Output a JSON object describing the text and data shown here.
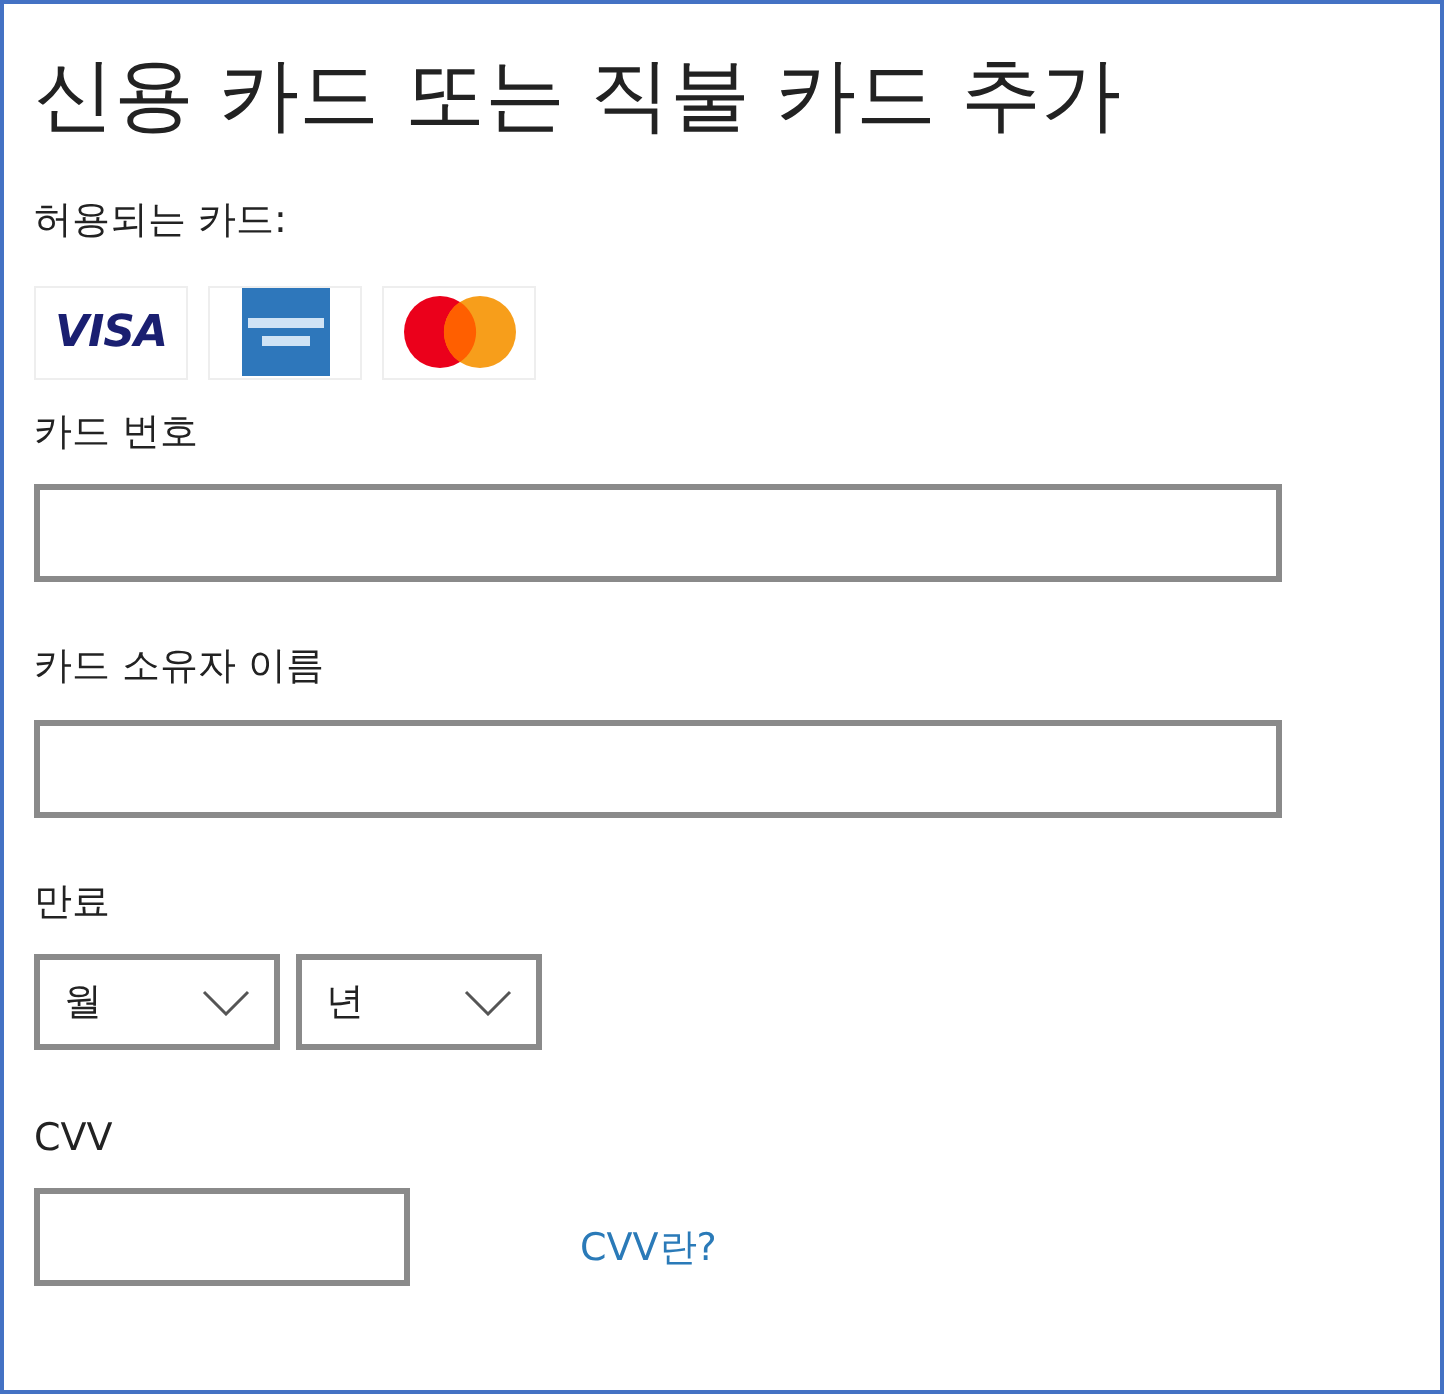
{
  "title": "신용 카드 또는 직불 카드 추가",
  "accepted_label": "허용되는 카드:",
  "cards": [
    {
      "kind": "visa",
      "text": "VISA"
    },
    {
      "kind": "amex"
    },
    {
      "kind": "mastercard"
    }
  ],
  "card_number": {
    "label": "카드 번호"
  },
  "holder_name": {
    "label": "카드 소유자 이름"
  },
  "expiry": {
    "label": "만료",
    "month": "월",
    "year": "년"
  },
  "cvv": {
    "label": "CVV",
    "help_link": "CVV란?"
  }
}
